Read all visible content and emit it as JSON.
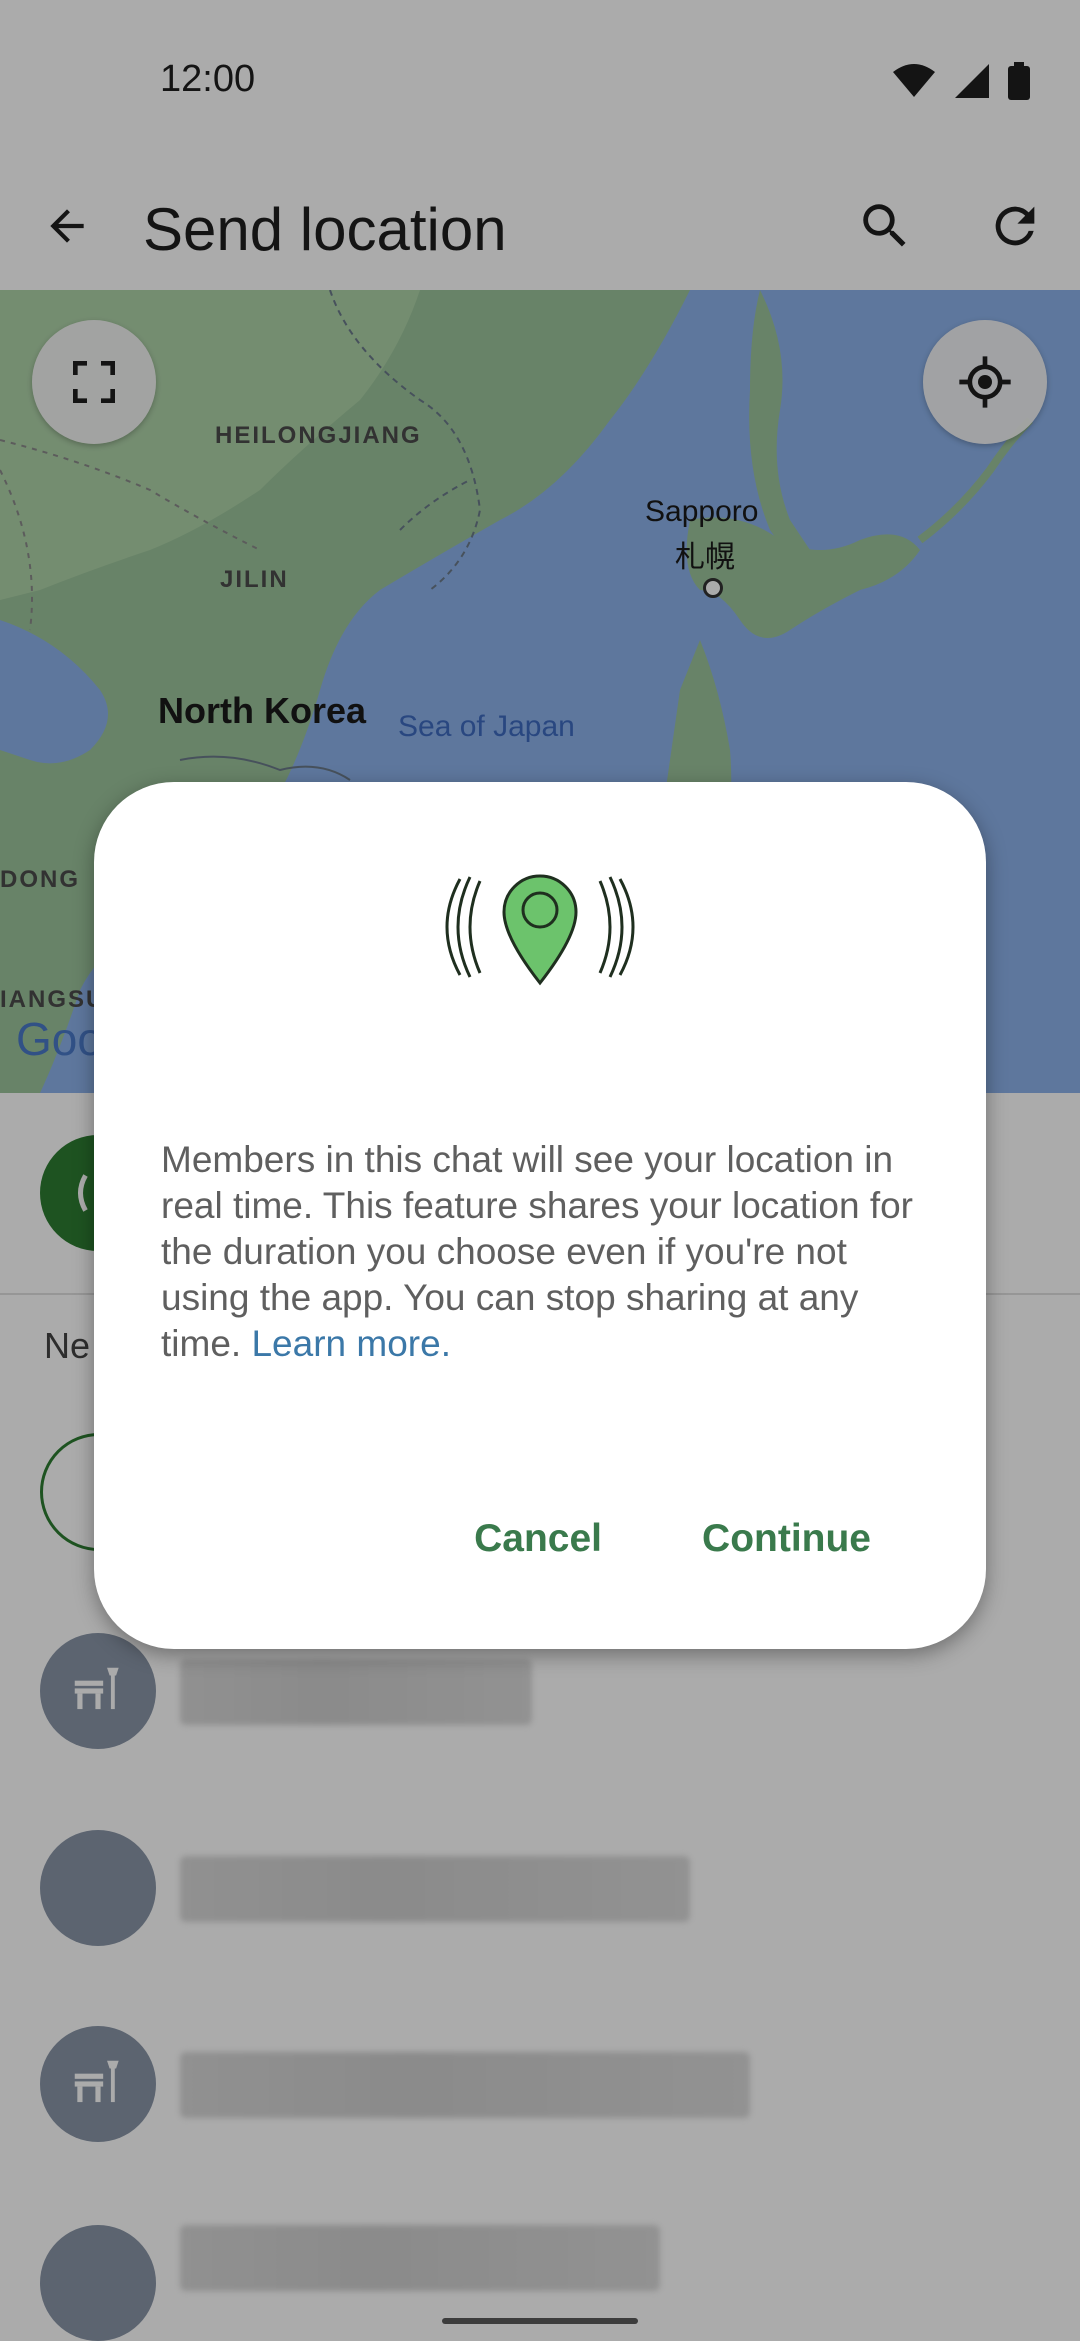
{
  "status_bar": {
    "time": "12:00"
  },
  "app_bar": {
    "title": "Send location"
  },
  "map": {
    "labels": {
      "heilongjiang": "HEILONGJIANG",
      "jilin": "JILIN",
      "north_korea": "North Korea",
      "sea_of_japan": "Sea of Japan",
      "sapporo": "Sapporo",
      "sapporo_jp": "札幌",
      "dong": "DONG",
      "jiangsu": "IANGSU",
      "google": "Goo"
    }
  },
  "list": {
    "section_label": "Ne"
  },
  "dialog": {
    "body_text": "Members in this chat will see your location in real time. This feature shares your location for the duration you choose even if you're not using the app. You can stop sharing at any time. ",
    "learn_more": "Learn more",
    "learn_more_suffix": ".",
    "cancel_label": "Cancel",
    "continue_label": "Continue"
  },
  "colors": {
    "accent_green": "#3a7a4c",
    "link_blue": "#3b78a8",
    "pin_green": "#6cc36c"
  }
}
